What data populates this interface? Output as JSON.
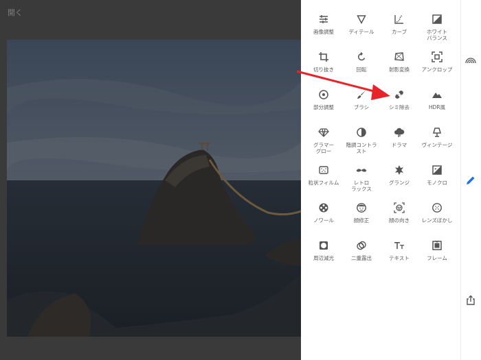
{
  "header": {
    "open_label": "開く"
  },
  "tools": [
    {
      "id": "tune-image",
      "label": "画像調整",
      "icon": "sliders-icon"
    },
    {
      "id": "details",
      "label": "ディテール",
      "icon": "triangle-icon"
    },
    {
      "id": "curves",
      "label": "カーブ",
      "icon": "curve-icon"
    },
    {
      "id": "white-balance",
      "label": "ホワイト\nバランス",
      "icon": "white-balance-icon"
    },
    {
      "id": "crop",
      "label": "切り抜き",
      "icon": "crop-icon"
    },
    {
      "id": "rotate",
      "label": "回転",
      "icon": "rotate-icon"
    },
    {
      "id": "perspective",
      "label": "射影変換",
      "icon": "perspective-icon"
    },
    {
      "id": "expand",
      "label": "アンクロップ",
      "icon": "expand-icon"
    },
    {
      "id": "selective",
      "label": "部分調整",
      "icon": "target-icon"
    },
    {
      "id": "brush",
      "label": "ブラシ",
      "icon": "brush-icon"
    },
    {
      "id": "healing",
      "label": "シミ除去",
      "icon": "bandage-icon"
    },
    {
      "id": "hdr",
      "label": "HDR風",
      "icon": "mountains-icon"
    },
    {
      "id": "glamour",
      "label": "グラマー\nグロー",
      "icon": "diamond-icon"
    },
    {
      "id": "tonal-contrast",
      "label": "階調コントラ\nスト",
      "icon": "half-circle-icon"
    },
    {
      "id": "drama",
      "label": "ドラマ",
      "icon": "cloud-icon"
    },
    {
      "id": "vintage",
      "label": "ヴィンテージ",
      "icon": "lamp-icon"
    },
    {
      "id": "grainy",
      "label": "粒状フィルム",
      "icon": "film-grain-icon"
    },
    {
      "id": "retrolux",
      "label": "レトロ\nラックス",
      "icon": "mustache-icon"
    },
    {
      "id": "grunge",
      "label": "グランジ",
      "icon": "grunge-icon"
    },
    {
      "id": "black-white",
      "label": "モノクロ",
      "icon": "bw-icon"
    },
    {
      "id": "noir",
      "label": "ノワール",
      "icon": "film-reel-icon"
    },
    {
      "id": "portrait",
      "label": "顔修正",
      "icon": "face-icon"
    },
    {
      "id": "head-pose",
      "label": "顔の向き",
      "icon": "face-frame-icon"
    },
    {
      "id": "lens-blur",
      "label": "レンズぼかし",
      "icon": "lens-blur-icon"
    },
    {
      "id": "vignette",
      "label": "周辺減光",
      "icon": "vignette-icon"
    },
    {
      "id": "double-exposure",
      "label": "二重露出",
      "icon": "double-exposure-icon"
    },
    {
      "id": "text",
      "label": "テキスト",
      "icon": "text-icon"
    },
    {
      "id": "frames",
      "label": "フレーム",
      "icon": "frame-icon"
    }
  ],
  "rail": {
    "looks_icon": "looks-icon",
    "tools_icon": "pencil-icon",
    "export_icon": "share-icon"
  },
  "colors": {
    "accent": "#1a73e8",
    "annotation_arrow": "#e8232a",
    "icon": "#555555"
  }
}
